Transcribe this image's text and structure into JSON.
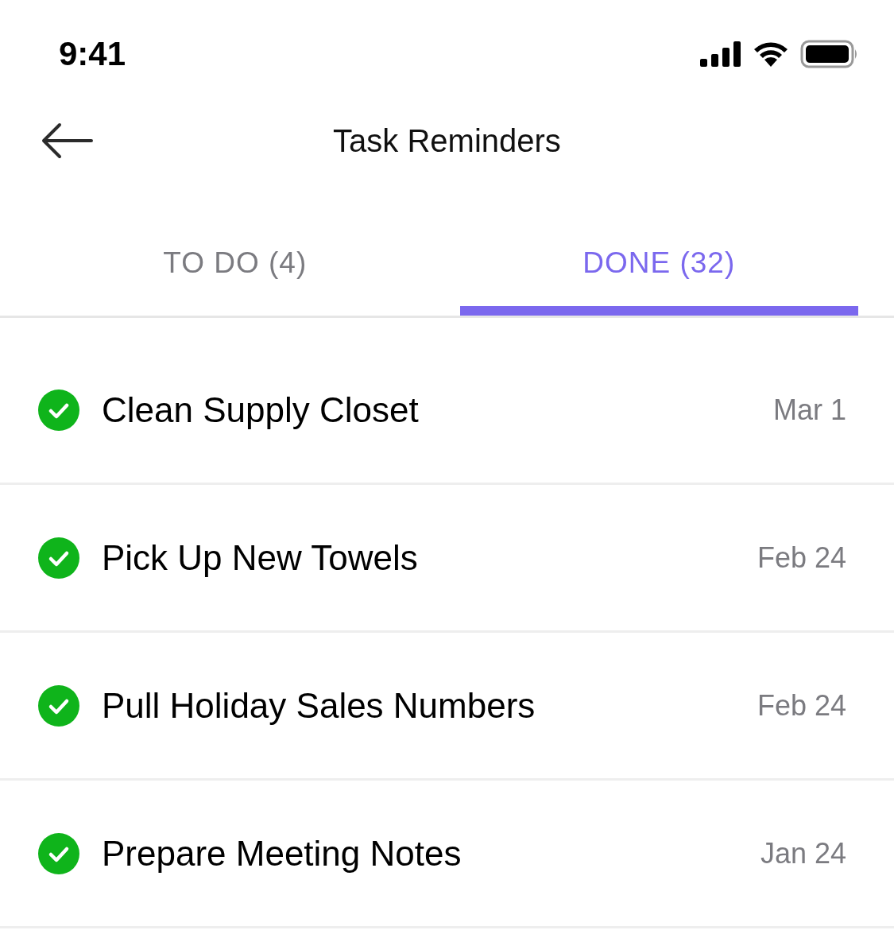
{
  "status_bar": {
    "time": "9:41"
  },
  "header": {
    "title": "Task Reminders"
  },
  "tabs": [
    {
      "label": "TO DO (4)",
      "selected": false
    },
    {
      "label": "DONE (32)",
      "selected": true
    }
  ],
  "tasks": [
    {
      "title": "Clean Supply Closet",
      "date": "Mar 1",
      "done": true
    },
    {
      "title": "Pick Up New Towels",
      "date": "Feb 24",
      "done": true
    },
    {
      "title": "Pull Holiday Sales Numbers",
      "date": "Feb 24",
      "done": true
    },
    {
      "title": "Prepare Meeting Notes",
      "date": "Jan 24",
      "done": true
    }
  ]
}
